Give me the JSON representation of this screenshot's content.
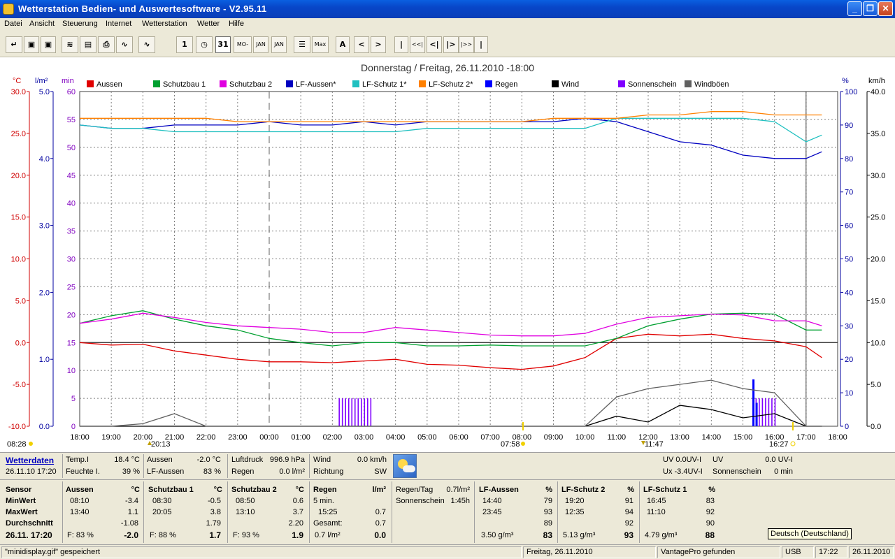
{
  "window": {
    "title": "Wetterstation Bedien- und Auswertesoftware - V2.95.11"
  },
  "menu": [
    "Datei",
    "Ansicht",
    "Steuerung",
    "Internet",
    "Wetterstation",
    "Wetter",
    "Hilfe"
  ],
  "toolbar": {
    "buttons": [
      {
        "icon": "open-icon",
        "glyph": "↵"
      },
      {
        "icon": "save-icon",
        "glyph": "▣"
      },
      {
        "icon": "save-disabled-icon",
        "glyph": "▣"
      },
      {
        "icon": "chart-view-icon",
        "glyph": "≋"
      },
      {
        "icon": "table-view-icon",
        "glyph": "▤"
      },
      {
        "icon": "print-icon",
        "glyph": "⎙"
      },
      {
        "icon": "graph-icon",
        "glyph": "∿"
      },
      {
        "icon": "graph2-icon",
        "glyph": "∿"
      },
      {
        "icon": "day-icon",
        "glyph": "1"
      },
      {
        "icon": "clock-icon",
        "glyph": "◷"
      },
      {
        "icon": "calendar-31-icon",
        "glyph": "31"
      },
      {
        "icon": "week-icon",
        "glyph": "MO-SO"
      },
      {
        "icon": "month-icon",
        "glyph": "JAN"
      },
      {
        "icon": "year-icon",
        "glyph": "JAN DEC"
      },
      {
        "icon": "list-icon",
        "glyph": "☰"
      },
      {
        "icon": "max-min-icon",
        "glyph": "Max Min"
      },
      {
        "icon": "auto-icon",
        "glyph": "A"
      },
      {
        "icon": "prev-icon",
        "glyph": "<"
      },
      {
        "icon": "next-icon",
        "glyph": ">"
      },
      {
        "icon": "start-icon",
        "glyph": "|"
      },
      {
        "icon": "rewind-fast-icon",
        "glyph": "<<|"
      },
      {
        "icon": "rewind-icon",
        "glyph": "<|"
      },
      {
        "icon": "forward-icon",
        "glyph": "|>"
      },
      {
        "icon": "forward-fast-icon",
        "glyph": "|>>"
      },
      {
        "icon": "end-icon",
        "glyph": "|"
      }
    ]
  },
  "chart": {
    "title": "Donnerstag / Freitag, 26.11.2010  -18:00",
    "axis_units": {
      "temp": "°C",
      "rain": "l/m²",
      "min": "min",
      "humidity": "%",
      "wind": "km/h"
    },
    "legend": [
      {
        "name": "Aussen",
        "color": "#e00000"
      },
      {
        "name": "Schutzbau 1",
        "color": "#00a030"
      },
      {
        "name": "Schutzbau 2",
        "color": "#e000e0"
      },
      {
        "name": "LF-Aussen*",
        "color": "#0000c0"
      },
      {
        "name": "LF-Schutz 1*",
        "color": "#20c0c0"
      },
      {
        "name": "LF-Schutz 2*",
        "color": "#ff8000"
      },
      {
        "name": "Regen",
        "color": "#0000ff"
      },
      {
        "name": "Wind",
        "color": "#000000"
      },
      {
        "name": "Sonnenschein",
        "color": "#8000ff"
      },
      {
        "name": "Windböen",
        "color": "#606060"
      }
    ],
    "annotations": {
      "sunrise": "07:58",
      "sunset": "16:27",
      "moonrise": "20:13",
      "moonset": "11:47",
      "left_marker": "08:28"
    }
  },
  "chart_data": {
    "type": "line",
    "x_ticks": [
      "18:00",
      "19:00",
      "20:00",
      "21:00",
      "22:00",
      "23:00",
      "00:00",
      "01:00",
      "02:00",
      "03:00",
      "04:00",
      "05:00",
      "06:00",
      "07:00",
      "08:00",
      "09:00",
      "10:00",
      "11:00",
      "12:00",
      "13:00",
      "14:00",
      "15:00",
      "16:00",
      "17:00",
      "18:00"
    ],
    "axes": {
      "temp_c": {
        "ticks": [
          "30.0",
          "25.0",
          "20.0",
          "15.0",
          "10.0",
          "5.0",
          "0.0",
          "-5.0",
          "-10.0"
        ],
        "range": [
          -10,
          30
        ]
      },
      "rain_lm2": {
        "ticks": [
          "5.0",
          "4.0",
          "3.0",
          "2.0",
          "1.0",
          "0.0"
        ],
        "range": [
          0,
          5
        ]
      },
      "minutes": {
        "ticks": [
          "60",
          "55",
          "50",
          "45",
          "40",
          "35",
          "30",
          "25",
          "20",
          "15",
          "10",
          "5",
          "0"
        ],
        "range": [
          0,
          60
        ]
      },
      "humidity_pct": {
        "ticks": [
          "100",
          "90",
          "80",
          "70",
          "60",
          "50",
          "40",
          "30",
          "20",
          "10",
          "0"
        ],
        "range": [
          0,
          100
        ]
      },
      "wind_kmh": {
        "ticks": [
          "40.0",
          "35.0",
          "30.0",
          "25.0",
          "20.0",
          "15.0",
          "10.0",
          "5.0",
          "0.0"
        ],
        "range": [
          0,
          40
        ]
      }
    },
    "hours": [
      0,
      1,
      2,
      3,
      4,
      5,
      6,
      7,
      8,
      9,
      10,
      11,
      12,
      13,
      14,
      15,
      16,
      17,
      18,
      19,
      20,
      21,
      22,
      23,
      23.5
    ],
    "series": [
      {
        "name": "Aussen",
        "axis": "temp_c",
        "values": [
          0.0,
          -0.3,
          -0.2,
          -1.0,
          -1.5,
          -2.0,
          -2.3,
          -2.3,
          -2.4,
          -2.2,
          -2.0,
          -2.6,
          -2.7,
          -3.0,
          -3.2,
          -2.8,
          -1.8,
          0.5,
          1.0,
          0.8,
          1.0,
          0.5,
          0.2,
          -0.5,
          -1.8
        ]
      },
      {
        "name": "Schutzbau 1",
        "axis": "temp_c",
        "values": [
          2.3,
          3.2,
          3.8,
          2.8,
          2.0,
          1.5,
          0.5,
          0.0,
          -0.4,
          0.0,
          0.0,
          -0.4,
          -0.4,
          -0.3,
          -0.4,
          -0.4,
          -0.4,
          0.5,
          2.0,
          2.8,
          3.4,
          3.5,
          3.4,
          1.5,
          1.5
        ]
      },
      {
        "name": "Schutzbau 2",
        "axis": "temp_c",
        "values": [
          2.3,
          2.8,
          3.5,
          3.0,
          2.4,
          2.0,
          1.8,
          1.6,
          1.2,
          1.2,
          1.8,
          1.5,
          1.2,
          0.9,
          0.8,
          0.8,
          1.1,
          2.2,
          3.0,
          3.2,
          3.4,
          3.3,
          2.6,
          2.6,
          2.0
        ]
      },
      {
        "name": "LF-Aussen*",
        "axis": "humidity_pct",
        "values": [
          90,
          89,
          89,
          90,
          90,
          90,
          91,
          90,
          90,
          91,
          90,
          91,
          91,
          91,
          91,
          91,
          92,
          91,
          88,
          85,
          84,
          81,
          80,
          80,
          82
        ]
      },
      {
        "name": "LF-Schutz 1*",
        "axis": "humidity_pct",
        "values": [
          90,
          89,
          89,
          88,
          88,
          88,
          88,
          88,
          88,
          88,
          88,
          89,
          89,
          89,
          89,
          89,
          89,
          92,
          92,
          92,
          92,
          92,
          91,
          85,
          87
        ]
      },
      {
        "name": "LF-Schutz 2*",
        "axis": "humidity_pct",
        "values": [
          92,
          92,
          92,
          92,
          92,
          91,
          91,
          91,
          91,
          91,
          91,
          91,
          91,
          91,
          91,
          92,
          92,
          92,
          93,
          93,
          94,
          94,
          93,
          93,
          93
        ]
      },
      {
        "name": "Wind",
        "axis": "wind_kmh",
        "values": [
          0,
          0,
          0,
          0,
          0,
          0,
          0,
          0,
          0,
          0,
          0,
          0,
          0,
          0,
          0,
          0,
          0,
          1.2,
          0.5,
          2.5,
          2.0,
          1.0,
          1.5,
          0,
          0
        ]
      },
      {
        "name": "Windböen",
        "axis": "wind_kmh",
        "values": [
          0,
          0,
          0.3,
          1.5,
          0,
          0,
          0,
          0,
          0,
          0,
          0,
          0,
          0,
          0,
          0,
          0,
          0,
          3.5,
          4.5,
          5.0,
          5.5,
          4.5,
          4.0,
          0,
          0
        ]
      }
    ],
    "bars": [
      {
        "name": "Sonnenschein",
        "axis": "minutes",
        "ranges": [
          [
            8.2,
            9.2,
            5
          ],
          [
            21.3,
            22.0,
            5
          ]
        ]
      },
      {
        "name": "Regen",
        "axis": "rain_lm2",
        "points": [
          [
            21.3,
            0.7
          ],
          [
            21.4,
            0.35
          ]
        ]
      }
    ],
    "reference_line": {
      "axis": "temp_c",
      "value": 0.0
    },
    "midnight_marker": "00:00"
  },
  "info": {
    "link": "Wetterdaten",
    "datetime": "26.11.10 17:20",
    "temp_i_label": "Temp.I",
    "temp_i_value": "18.4 °C",
    "feuchte_label": "Feuchte I.",
    "feuchte_value": "39 %",
    "aussen_label": "Aussen",
    "aussen_value": "-2.0 °C",
    "lf_aussen_label": "LF-Aussen",
    "lf_aussen_value": "83 %",
    "luftdruck_label": "Luftdruck",
    "luftdruck_value": "996.9 hPa",
    "regen_label": "Regen",
    "regen_value": "0.0 l/m²",
    "wind_label": "Wind",
    "wind_value": "0.0 km/h",
    "richtung_label": "Richtung",
    "richtung_value": "SW",
    "uv_label": "UV 0.0UV-I",
    "ux_label": "Ux -3.4UV-I",
    "uv2_label": "UV",
    "uv2_value": "0.0 UV-I",
    "sonnenschein_label": "Sonnenschein",
    "sonnenschein_value": "0 min"
  },
  "stats": {
    "row_labels": [
      "Sensor",
      "MinWert",
      "MaxWert",
      "Durchschnitt",
      "26.11. 17:20"
    ],
    "aussen": {
      "header": "Aussen",
      "unit": "°C",
      "min_time": "08:10",
      "min": "-3.4",
      "max_time": "13:40",
      "max": "1.1",
      "avg": "-1.08",
      "humidity": "F: 83 %",
      "current": "-2.0"
    },
    "schutzbau1": {
      "header": "Schutzbau 1",
      "unit": "°C",
      "min_time": "08:30",
      "min": "-0.5",
      "max_time": "20:05",
      "max": "3.8",
      "avg": "1.79",
      "humidity": "F: 88 %",
      "current": "1.7"
    },
    "schutzbau2": {
      "header": "Schutzbau 2",
      "unit": "°C",
      "min_time": "08:50",
      "min": "0.6",
      "max_time": "13:10",
      "max": "3.7",
      "avg": "2.20",
      "humidity": "F: 93 %",
      "current": "1.9"
    },
    "regen": {
      "header": "Regen",
      "unit": "l/m²",
      "r1": "5 min.",
      "r2_time": "15:25",
      "r2": "0.7",
      "r3_label": "Gesamt:",
      "r3": "0.7",
      "r4": "0.7 l/m²",
      "current": "0.0"
    },
    "regentag": {
      "label1": "Regen/Tag",
      "value1": "0.7l/m²",
      "label2": "Sonnenschein",
      "value2": "1:45h"
    },
    "lf_aussen": {
      "header": "LF-Aussen",
      "unit": "%",
      "min_time": "14:40",
      "min": "79",
      "max_time": "23:45",
      "max": "93",
      "avg": "89",
      "abs": "3.50 g/m³",
      "current": "83"
    },
    "lf_schutz2": {
      "header": "LF-Schutz 2",
      "unit": "%",
      "min_time": "19:20",
      "min": "91",
      "max_time": "12:35",
      "max": "94",
      "avg": "92",
      "abs": "5.13 g/m³",
      "current": "93"
    },
    "lf_schutz1": {
      "header": "LF-Schutz 1",
      "unit": "%",
      "min_time": "16:45",
      "min": "83",
      "max_time": "11:10",
      "max": "92",
      "avg": "90",
      "abs": "4.79 g/m³",
      "current": "88"
    },
    "language_tip": "Deutsch (Deutschland)"
  },
  "statusbar": {
    "message": "\"minidisplay.gif\"  gespeichert",
    "date": "Freitag, 26.11.2010",
    "station": "VantagePro gefunden",
    "port": "USB",
    "time": "17:22",
    "date2": "26.11.2010"
  }
}
